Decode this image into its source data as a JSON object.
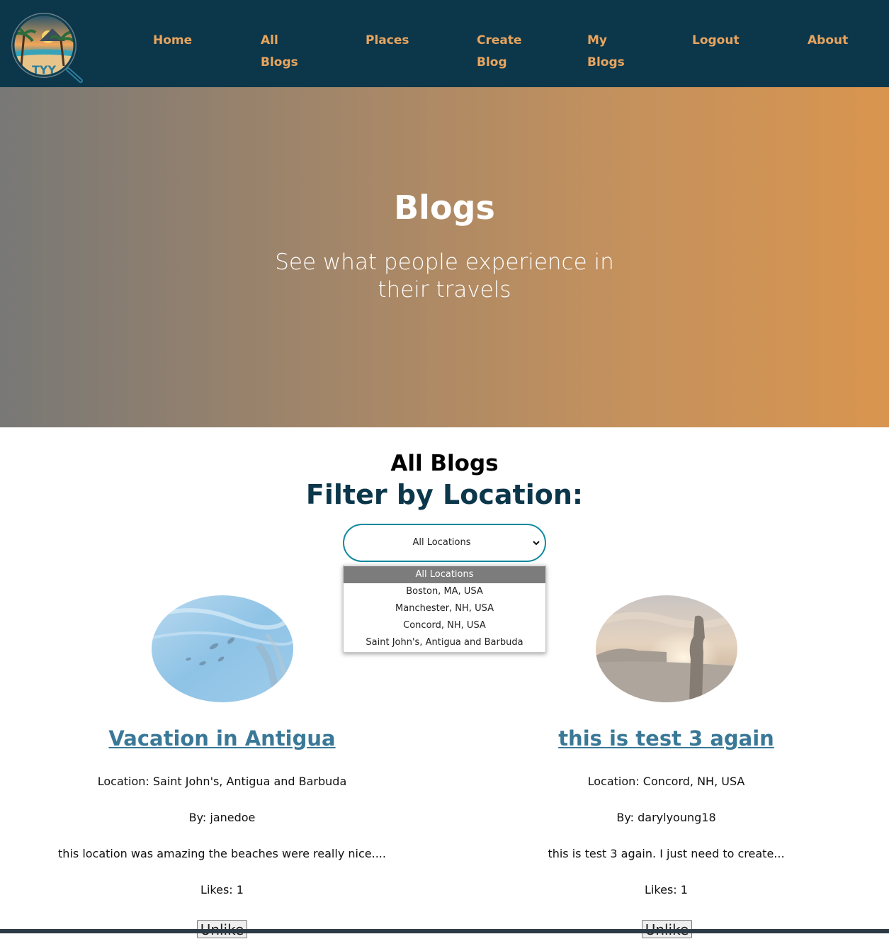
{
  "nav": {
    "logo_icon": "travel-logo-icon",
    "items": [
      {
        "lines": [
          "Home"
        ]
      },
      {
        "lines": [
          "All",
          "Blogs"
        ]
      },
      {
        "lines": [
          "Places"
        ]
      },
      {
        "lines": [
          "Create",
          "Blog"
        ]
      },
      {
        "lines": [
          "My",
          "Blogs"
        ]
      },
      {
        "lines": [
          "Logout"
        ]
      },
      {
        "lines": [
          "About"
        ]
      }
    ],
    "link_color": "#e8a55f",
    "background": "#0c374b"
  },
  "hero": {
    "title": "Blogs",
    "subtitle": "See what people experience in their travels"
  },
  "main": {
    "section_title": "All Blogs",
    "filter_title": "Filter by Location:",
    "filter": {
      "selected": "All Locations",
      "options": [
        "All Locations",
        "Boston, MA, USA",
        "Manchester, NH, USA",
        "Concord, NH, USA",
        "Saint John's, Antigua and Barbuda"
      ]
    },
    "posts": [
      {
        "title": "Vacation in Antigua",
        "location": "Location: Saint John's, Antigua and Barbuda",
        "author": "By: janedoe",
        "excerpt": "this location was amazing the beaches were really nice....",
        "likes": "Likes: 1",
        "button_label": "Unlike",
        "image_icon": "underwater-photo"
      },
      {
        "title": "this is test 3 again",
        "location": "Location: Concord, NH, USA",
        "author": "By: darylyoung18",
        "excerpt": "this is test 3 again. I just need to create...",
        "likes": "Likes: 1",
        "button_label": "Unlike",
        "image_icon": "sunset-statue-photo"
      }
    ]
  },
  "colors": {
    "accent": "#138a9e",
    "link": "#3a7897",
    "heading_dark": "#0c374b"
  }
}
